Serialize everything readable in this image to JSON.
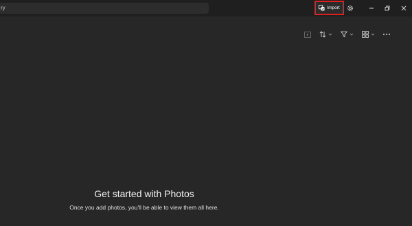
{
  "search": {
    "value": "ry"
  },
  "header": {
    "import_label": "Import"
  },
  "icons": {
    "import": "import-icon",
    "settings": "gear-icon",
    "minimize": "minimize-icon",
    "restore": "restore-icon",
    "close": "close-icon",
    "slideshow": "slideshow-icon",
    "sort": "sort-icon",
    "filter": "filter-icon",
    "view": "view-grid-icon",
    "more": "more-icon"
  },
  "empty_state": {
    "title": "Get started with Photos",
    "subtitle": "Once you add photos, you'll be able to view them all here."
  },
  "colors": {
    "highlight": "#e01f1f",
    "background": "#272727",
    "titlebar": "#1f1f1f"
  }
}
